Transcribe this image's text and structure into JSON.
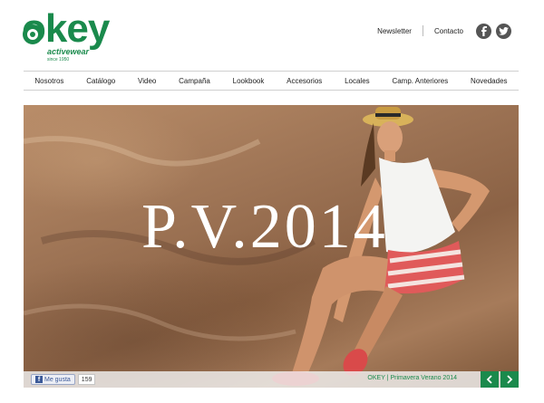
{
  "brand": {
    "name": "okey",
    "tagline": "activewear",
    "since": "since 1950",
    "color": "#1a8a4c"
  },
  "header": {
    "links": [
      "Newsletter",
      "Contacto"
    ],
    "social": [
      {
        "icon": "facebook-icon"
      },
      {
        "icon": "twitter-icon"
      }
    ]
  },
  "nav": {
    "items": [
      "Nosotros",
      "Catálogo",
      "Video",
      "Campaña",
      "Lookbook",
      "Accesorios",
      "Locales",
      "Camp. Anteriores",
      "Novedades"
    ]
  },
  "hero": {
    "title": "P.V.2014",
    "like_label": "Me gusta",
    "like_count": "159",
    "caption": "OKEY  |  Primavera Verano 2014",
    "prev_icon": "chevron-left-icon",
    "next_icon": "chevron-right-icon"
  }
}
